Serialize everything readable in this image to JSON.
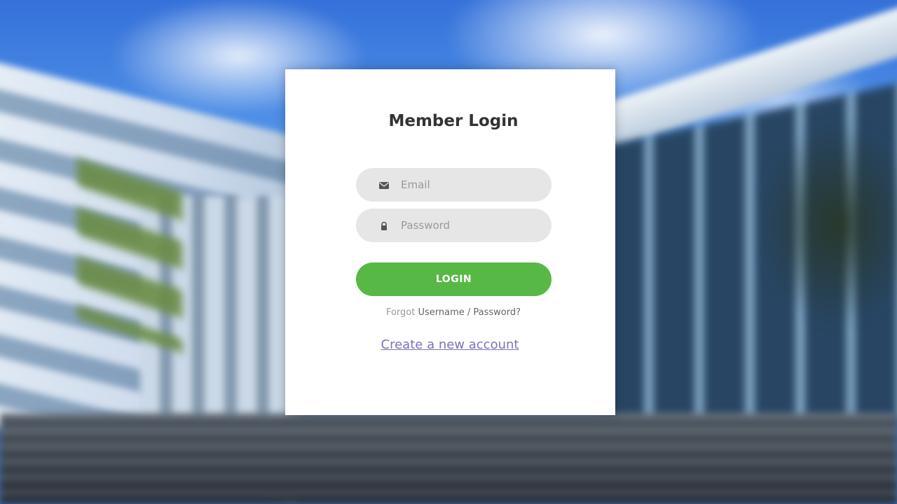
{
  "login": {
    "title": "Member Login",
    "email_placeholder": "Email",
    "email_icon": "envelope-icon",
    "password_placeholder": "Password",
    "password_icon": "lock-icon",
    "login_label": "LOGIN",
    "forgot_prefix": "Forgot",
    "forgot_link": "Username / Password?",
    "create_account_label": "Create a new account"
  },
  "colors": {
    "accent": "#57b846",
    "field_background": "#e6e6e6",
    "link": "#7b74b8"
  }
}
